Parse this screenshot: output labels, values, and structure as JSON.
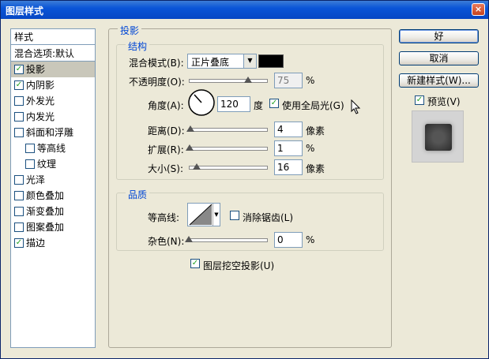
{
  "window": {
    "title": "图层样式",
    "close_glyph": "×"
  },
  "style_list": {
    "header": "样式",
    "items": [
      {
        "label": "混合选项:默认",
        "checkbox": false,
        "checked": false,
        "indent": 0
      },
      {
        "label": "投影",
        "checkbox": true,
        "checked": true,
        "indent": 0,
        "selected": true
      },
      {
        "label": "内阴影",
        "checkbox": true,
        "checked": true,
        "indent": 0
      },
      {
        "label": "外发光",
        "checkbox": true,
        "checked": false,
        "indent": 0
      },
      {
        "label": "内发光",
        "checkbox": true,
        "checked": false,
        "indent": 0
      },
      {
        "label": "斜面和浮雕",
        "checkbox": true,
        "checked": false,
        "indent": 0
      },
      {
        "label": "等高线",
        "checkbox": true,
        "checked": false,
        "indent": 1
      },
      {
        "label": "纹理",
        "checkbox": true,
        "checked": false,
        "indent": 1
      },
      {
        "label": "光泽",
        "checkbox": true,
        "checked": false,
        "indent": 0
      },
      {
        "label": "颜色叠加",
        "checkbox": true,
        "checked": false,
        "indent": 0
      },
      {
        "label": "渐变叠加",
        "checkbox": true,
        "checked": false,
        "indent": 0
      },
      {
        "label": "图案叠加",
        "checkbox": true,
        "checked": false,
        "indent": 0
      },
      {
        "label": "描边",
        "checkbox": true,
        "checked": true,
        "indent": 0
      }
    ]
  },
  "drop_shadow": {
    "group_title": "投影",
    "structure": {
      "title": "结构",
      "blend_mode_label": "混合模式(B):",
      "blend_mode_value": "正片叠底",
      "shadow_color": "#000000",
      "opacity_label": "不透明度(O):",
      "opacity_value": "75",
      "opacity_unit": "%",
      "opacity_level": 0.75,
      "angle_label": "角度(A):",
      "angle_value": "120",
      "angle_unit": "度",
      "global_light_label": "使用全局光(G)",
      "global_light_checked": true,
      "distance_label": "距离(D):",
      "distance_value": "4",
      "distance_unit": "像素",
      "distance_level": 0.02,
      "spread_label": "扩展(R):",
      "spread_value": "1",
      "spread_unit": "%",
      "spread_level": 0.01,
      "size_label": "大小(S):",
      "size_value": "16",
      "size_unit": "像素",
      "size_level": 0.1
    },
    "quality": {
      "title": "品质",
      "contour_label": "等高线:",
      "antialias_label": "消除锯齿(L)",
      "antialias_checked": false,
      "noise_label": "杂色(N):",
      "noise_value": "0",
      "noise_unit": "%",
      "noise_level": 0.0
    },
    "knockout_label": "图层挖空投影(U)",
    "knockout_checked": true
  },
  "buttons": {
    "ok": "好",
    "cancel": "取消",
    "new_style": "新建样式(W)...",
    "preview_label": "预览(V)",
    "preview_checked": true
  },
  "check_glyph": "✓"
}
